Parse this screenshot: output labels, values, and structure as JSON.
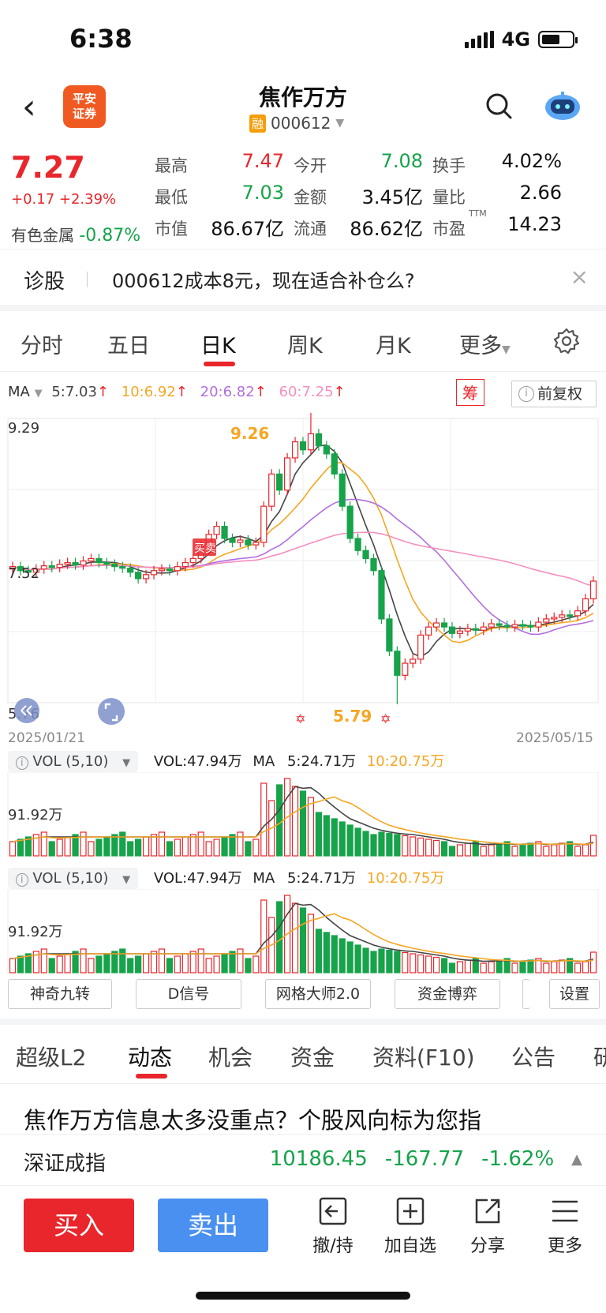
{
  "status": {
    "time": "6:38",
    "network": "4G"
  },
  "header": {
    "logo_line1": "平安",
    "logo_line2": "证券",
    "stock_name": "焦作万方",
    "rong_badge": "融",
    "stock_code": "000612"
  },
  "quote": {
    "price": "7.27",
    "change": "+0.17 +2.39%",
    "sector_name": "有色金属",
    "sector_change": "-0.87%",
    "cells": [
      {
        "label": "最高",
        "value": "7.47",
        "color": "red"
      },
      {
        "label": "今开",
        "value": "7.08",
        "color": "green"
      },
      {
        "label": "换手",
        "value": "4.02%",
        "color": "black"
      },
      {
        "label": "最低",
        "value": "7.03",
        "color": "green"
      },
      {
        "label": "金额",
        "value": "3.45亿",
        "color": "black"
      },
      {
        "label": "量比",
        "value": "2.66",
        "color": "black"
      },
      {
        "label": "市值",
        "value": "86.67亿",
        "color": "black"
      },
      {
        "label": "流通",
        "value": "86.62亿",
        "color": "black"
      },
      {
        "label": "市盈",
        "value": "14.23",
        "color": "black",
        "sup": "TTM"
      }
    ]
  },
  "ask": {
    "label": "诊股",
    "text": "000612成本8元，现在适合补仓么?",
    "close": "×"
  },
  "tabs": [
    "分时",
    "五日",
    "日K",
    "周K",
    "月K",
    "更多"
  ],
  "active_tab": "日K",
  "ma": {
    "label": "MA",
    "ma5": "5:7.03",
    "ma10": "10:6.92",
    "ma20": "20:6.82",
    "ma60": "60:7.25",
    "chou": "筹",
    "fuquan": "前复权"
  },
  "kline": {
    "y_top": "9.29",
    "y_mid": "7.52",
    "y_bottom": "5.76",
    "high_label": "9.26",
    "low_label": "5.79",
    "date_start": "2025/01/21",
    "date_end": "2025/05/15",
    "marker": "买卖"
  },
  "volume_panels": [
    {
      "indicator": "VOL (5,10)",
      "vol": "VOL:47.94万",
      "ma_label": "MA",
      "ma5": "5:24.71万",
      "ma10": "10:20.75万",
      "y_label": "91.92万"
    },
    {
      "indicator": "VOL (5,10)",
      "vol": "VOL:47.94万",
      "ma_label": "MA",
      "ma5": "5:24.71万",
      "ma10": "10:20.75万",
      "y_label": "91.92万"
    }
  ],
  "tools": [
    "神奇九转",
    "D信号",
    "网格大师2.0",
    "资金博弈",
    "设置"
  ],
  "bottom_tabs": [
    "超级L2",
    "动态",
    "机会",
    "资金",
    "资料(F10)",
    "公告",
    "研"
  ],
  "news": "焦作万方信息太多没重点？个股风向标为您指",
  "index": {
    "name": "深证成指",
    "value": "10186.45",
    "change": "-167.77",
    "percent": "-1.62%"
  },
  "actions": {
    "buy": "买入",
    "sell": "卖出",
    "withdraw": "撤/持",
    "add": "加自选",
    "share": "分享",
    "more": "更多"
  },
  "colors": {
    "up": "#e8262b",
    "down": "#16a34a",
    "ma5": "#444444",
    "ma10": "#f5a623",
    "ma20": "#b06fe0",
    "ma60": "#f48fc0"
  }
}
